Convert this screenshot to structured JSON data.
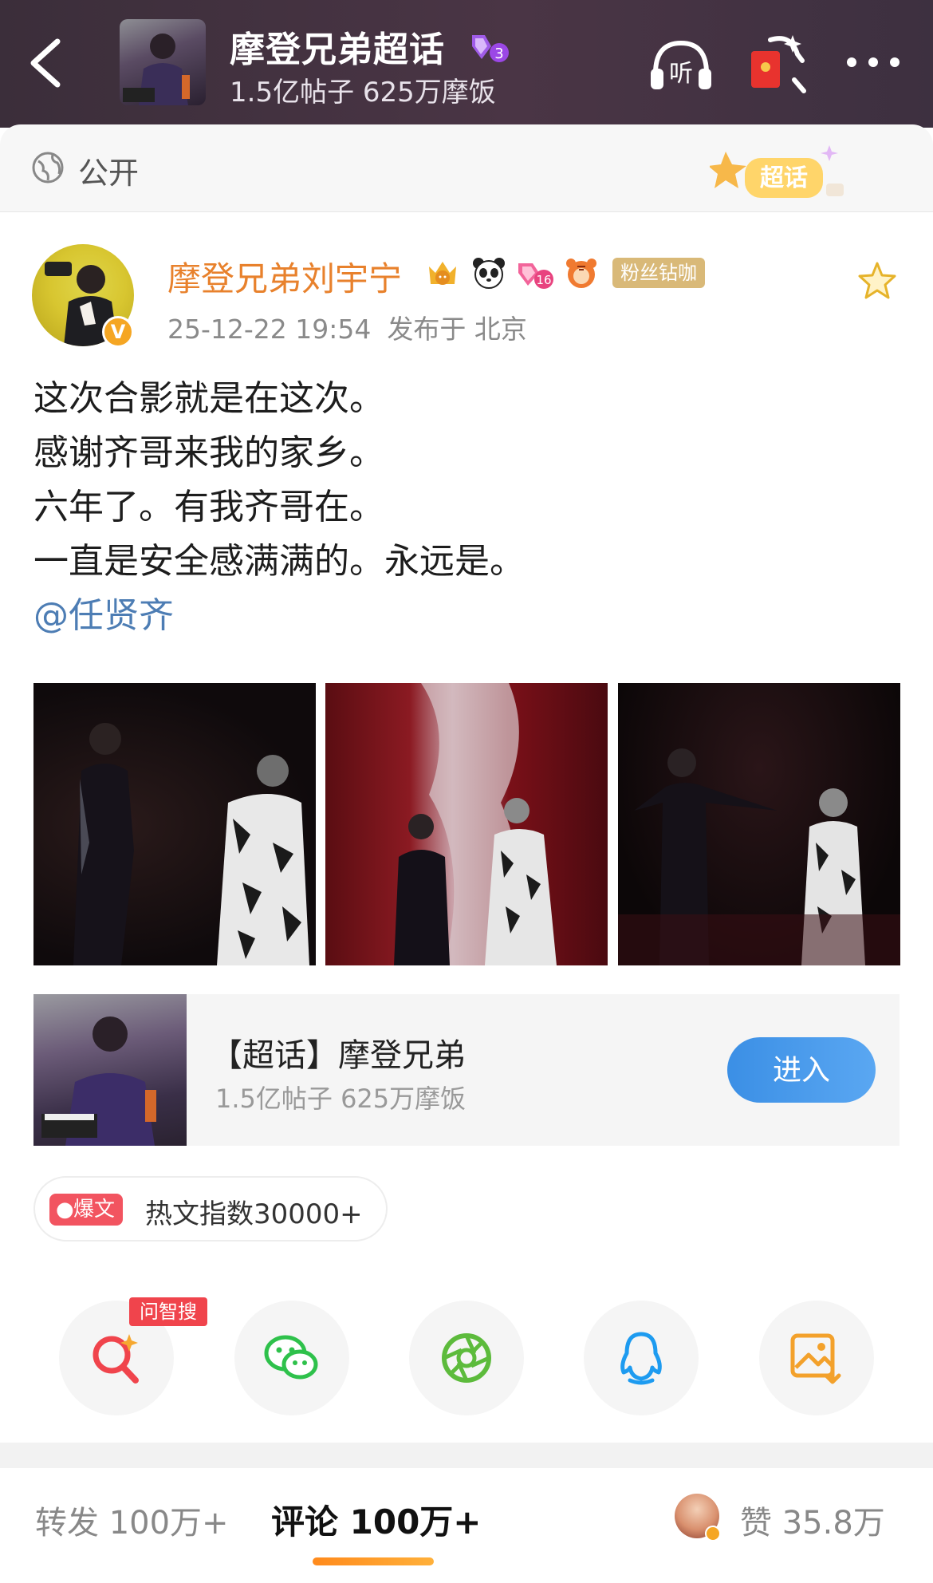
{
  "header": {
    "title": "摩登兄弟超话",
    "level_badge": "3",
    "subtitle": "1.5亿帖子 625万摩饭",
    "listen_icon": "listen-icon",
    "redpacket_icon": "red-packet-icon",
    "more_icon": "more-icon"
  },
  "visibility": {
    "label": "公开",
    "deco_text": "超话"
  },
  "post": {
    "author": "摩登兄弟刘宇宁",
    "verified_mark": "V",
    "fan_badge": "粉丝钻咖",
    "member_level": "16",
    "timestamp": "25-12-22 19:54",
    "location": "发布于 北京",
    "lines": [
      "这次合影就是在这次。",
      "感谢齐哥来我的家乡。",
      "六年了。有我齐哥在。",
      "一直是安全感满满的。永远是。"
    ],
    "mention": "@任贤齐"
  },
  "topic_card": {
    "title": "【超话】摩登兄弟",
    "subtitle": "1.5亿帖子 625万摩饭",
    "enter_label": "进入"
  },
  "hot": {
    "tag": "爆文",
    "text": "热文指数30000+"
  },
  "share": {
    "ask_tag": "问智搜",
    "icons": [
      "ai-search-icon",
      "wechat-icon",
      "moments-icon",
      "qq-icon",
      "save-image-icon"
    ]
  },
  "tabs": {
    "repost": "转发 100万+",
    "comment": "评论 100万+",
    "like": "赞 35.8万"
  },
  "colors": {
    "accent_orange": "#e8812c",
    "link_blue": "#4d7db4",
    "enter_blue": "#3b8fe5",
    "hot_red": "#f25460"
  }
}
